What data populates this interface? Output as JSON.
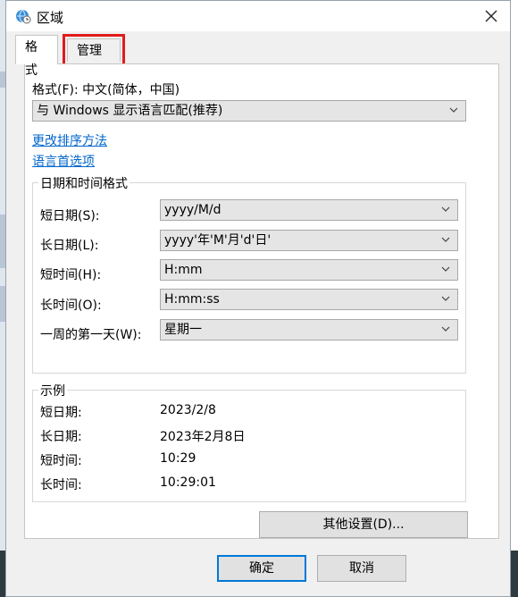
{
  "window": {
    "title": "区域"
  },
  "tabs": [
    {
      "label": "格式",
      "active": true
    },
    {
      "label": "管理",
      "active": false,
      "highlighted": true
    }
  ],
  "format": {
    "label": "格式(F): 中文(简体，中国)",
    "selected": "与 Windows 显示语言匹配(推荐)"
  },
  "links": {
    "change_sort": "更改排序方法",
    "language_prefs": "语言首选项"
  },
  "datetime_group": {
    "title": "日期和时间格式",
    "rows": [
      {
        "label": "短日期(S):",
        "value": "yyyy/M/d"
      },
      {
        "label": "长日期(L):",
        "value": "yyyy'年'M'月'd'日'"
      },
      {
        "label": "短时间(H):",
        "value": "H:mm"
      },
      {
        "label": "长时间(O):",
        "value": "H:mm:ss"
      },
      {
        "label": "一周的第一天(W):",
        "value": "星期一"
      }
    ]
  },
  "examples": {
    "title": "示例",
    "rows": [
      {
        "label": "短日期:",
        "value": "2023/2/8"
      },
      {
        "label": "长日期:",
        "value": "2023年2月8日"
      },
      {
        "label": "短时间:",
        "value": "10:29"
      },
      {
        "label": "长时间:",
        "value": "10:29:01"
      }
    ]
  },
  "buttons": {
    "other_settings": "其他设置(D)...",
    "ok": "确定",
    "cancel": "取消"
  },
  "colors": {
    "link": "#0066cc",
    "highlight_box": "#e21b1b",
    "primary_border": "#0078d7"
  },
  "icons": {
    "app": "globe-clock-icon",
    "close": "close-icon",
    "dropdown": "chevron-down-icon"
  }
}
